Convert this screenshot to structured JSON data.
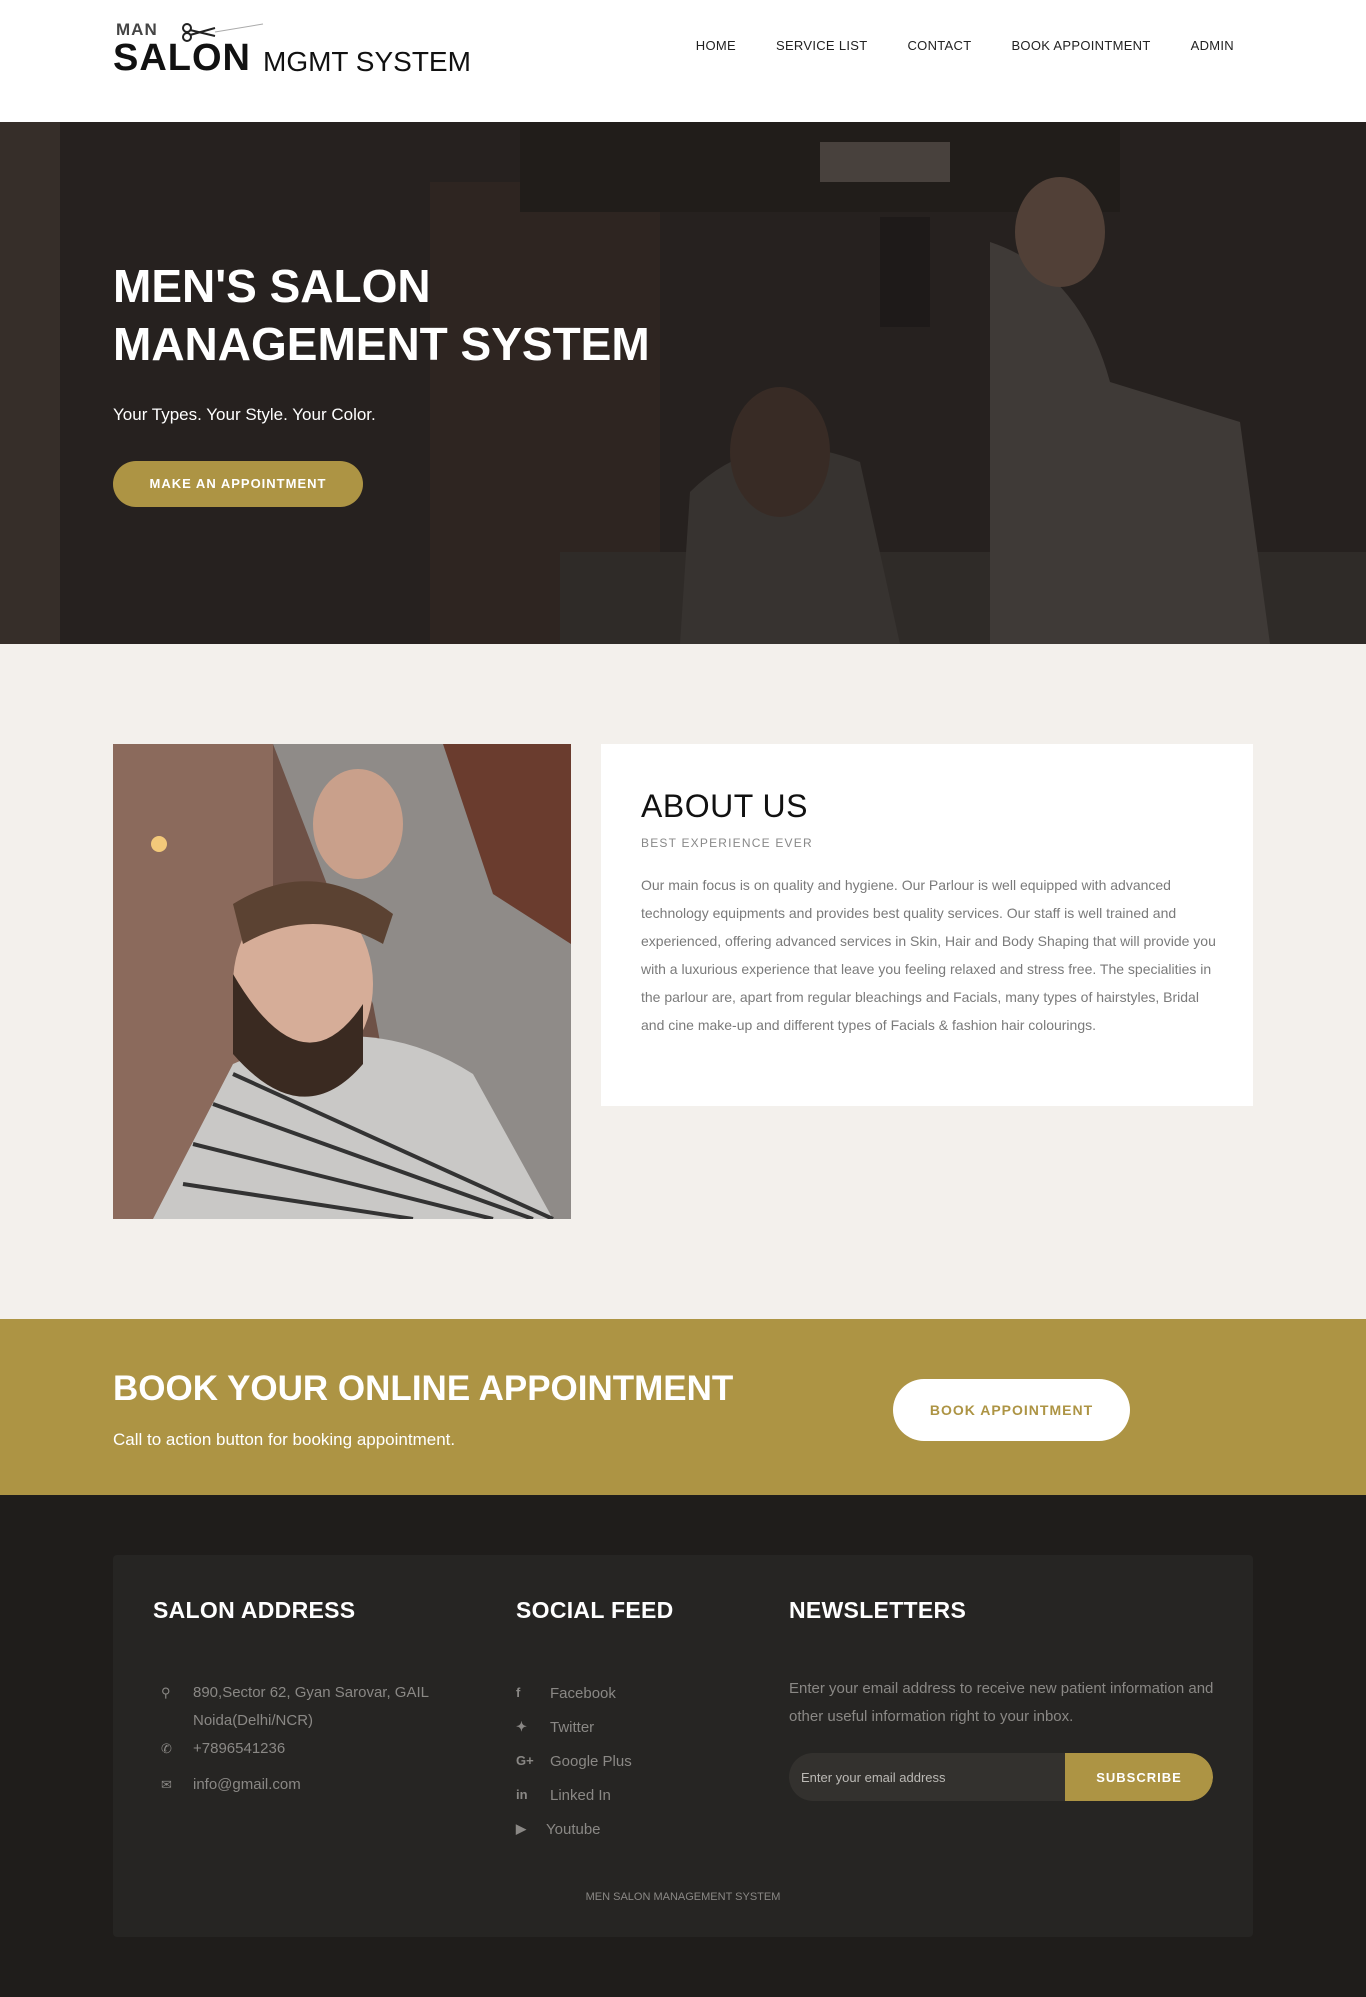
{
  "header": {
    "logo": {
      "man": "MAN",
      "salon": "SALON",
      "rest": "MGMT SYSTEM"
    },
    "nav": [
      "HOME",
      "SERVICE LIST",
      "CONTACT",
      "BOOK APPOINTMENT",
      "ADMIN"
    ]
  },
  "hero": {
    "title_line1": "MEN'S SALON",
    "title_line2": "MANAGEMENT SYSTEM",
    "subtitle": "Your Types. Your Style. Your Color.",
    "button": "MAKE AN APPOINTMENT"
  },
  "about": {
    "title": "ABOUT US",
    "kicker": "BEST EXPERIENCE EVER",
    "text": "Our main focus is on quality and hygiene. Our Parlour is well equipped with advanced technology equipments and provides best quality services. Our staff is well trained and experienced, offering advanced services in Skin, Hair and Body Shaping that will provide you with a luxurious experience that leave you feeling relaxed and stress free. The specialities in the parlour are, apart from regular bleachings and Facials, many types of hairstyles, Bridal and cine make-up and different types of Facials & fashion hair colourings."
  },
  "cta": {
    "title": "BOOK YOUR ONLINE APPOINTMENT",
    "subtitle": "Call to action button for booking appointment.",
    "button": "BOOK APPOINTMENT"
  },
  "footer": {
    "address": {
      "title": "SALON ADDRESS",
      "street": "890,Sector 62, Gyan Sarovar, GAIL",
      "city": "Noida(Delhi/NCR)",
      "phone": "+7896541236",
      "email": "info@gmail.com"
    },
    "social": {
      "title": "SOCIAL FEED",
      "items": [
        {
          "icon": "facebook-icon",
          "label": "Facebook"
        },
        {
          "icon": "twitter-icon",
          "label": "Twitter"
        },
        {
          "icon": "google-plus-icon",
          "label": "Google Plus"
        },
        {
          "icon": "linkedin-icon",
          "label": "Linked In"
        },
        {
          "icon": "youtube-icon",
          "label": "Youtube"
        }
      ]
    },
    "newsletter": {
      "title": "NEWSLETTERS",
      "text": "Enter your email address to receive new patient information and other useful information right to your inbox.",
      "placeholder": "Enter your email address",
      "button": "SUBSCRIBE"
    },
    "copyright": "MEN SALON MANAGEMENT SYSTEM"
  },
  "colors": {
    "accent": "#ad9444",
    "footer_bg": "#1f1d1b",
    "about_bg": "#f3f0ec"
  }
}
